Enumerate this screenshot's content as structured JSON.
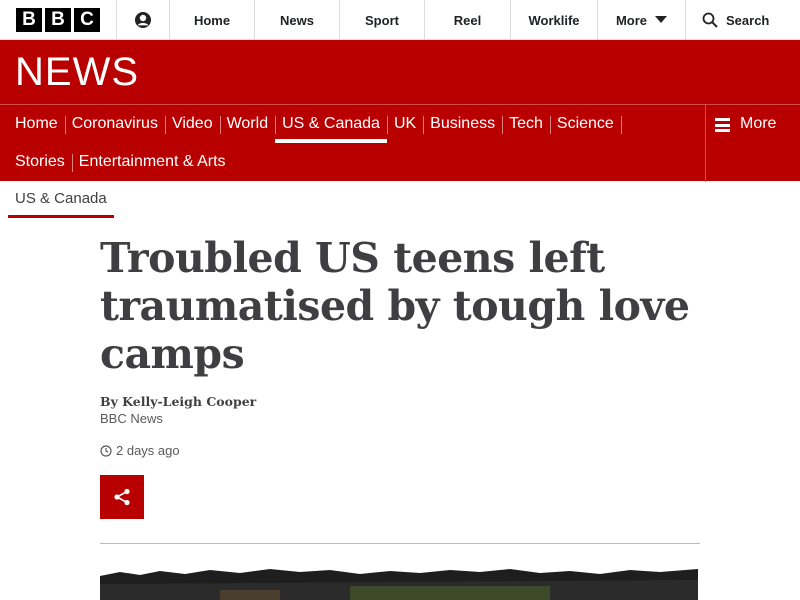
{
  "brand": {
    "logo_letters": [
      "B",
      "B",
      "C"
    ]
  },
  "topnav": {
    "items": [
      "Home",
      "News",
      "Sport",
      "Reel",
      "Worklife",
      "More"
    ],
    "search_label": "Search"
  },
  "masthead": {
    "title": "NEWS"
  },
  "section_nav": {
    "row1": [
      "Home",
      "Coronavirus",
      "Video",
      "World",
      "US & Canada",
      "UK",
      "Business",
      "Tech",
      "Science"
    ],
    "row2": [
      "Stories",
      "Entertainment & Arts"
    ],
    "active": "US & Canada",
    "more_label": "More"
  },
  "subsection": {
    "label": "US & Canada"
  },
  "article": {
    "headline_lines": [
      "Troubled US teens left",
      "traumatised by tough love",
      "camps"
    ],
    "byline": "By Kelly-Leigh Cooper",
    "source": "BBC News",
    "timestamp": "2 days ago"
  },
  "colors": {
    "brand_red": "#b80000",
    "text_dark": "#3f3f42"
  },
  "icons": [
    "account-icon",
    "chevron-down-icon",
    "search-icon",
    "hamburger-icon",
    "clock-icon",
    "share-icon"
  ]
}
